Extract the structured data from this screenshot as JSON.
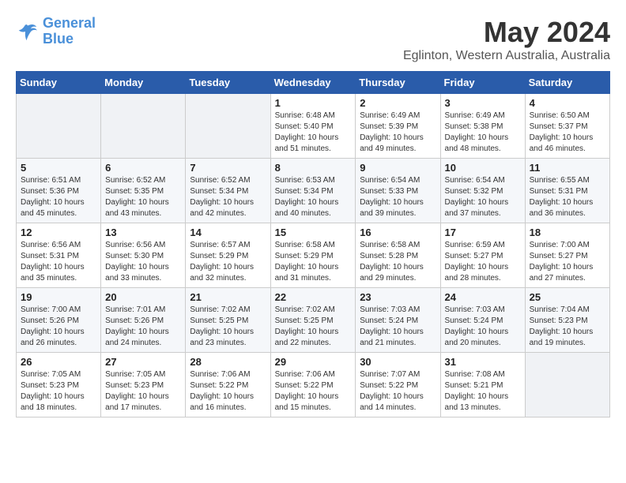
{
  "header": {
    "logo_line1": "General",
    "logo_line2": "Blue",
    "month_title": "May 2024",
    "subtitle": "Eglinton, Western Australia, Australia"
  },
  "weekdays": [
    "Sunday",
    "Monday",
    "Tuesday",
    "Wednesday",
    "Thursday",
    "Friday",
    "Saturday"
  ],
  "weeks": [
    [
      {
        "day": "",
        "info": ""
      },
      {
        "day": "",
        "info": ""
      },
      {
        "day": "",
        "info": ""
      },
      {
        "day": "1",
        "info": "Sunrise: 6:48 AM\nSunset: 5:40 PM\nDaylight: 10 hours\nand 51 minutes."
      },
      {
        "day": "2",
        "info": "Sunrise: 6:49 AM\nSunset: 5:39 PM\nDaylight: 10 hours\nand 49 minutes."
      },
      {
        "day": "3",
        "info": "Sunrise: 6:49 AM\nSunset: 5:38 PM\nDaylight: 10 hours\nand 48 minutes."
      },
      {
        "day": "4",
        "info": "Sunrise: 6:50 AM\nSunset: 5:37 PM\nDaylight: 10 hours\nand 46 minutes."
      }
    ],
    [
      {
        "day": "5",
        "info": "Sunrise: 6:51 AM\nSunset: 5:36 PM\nDaylight: 10 hours\nand 45 minutes."
      },
      {
        "day": "6",
        "info": "Sunrise: 6:52 AM\nSunset: 5:35 PM\nDaylight: 10 hours\nand 43 minutes."
      },
      {
        "day": "7",
        "info": "Sunrise: 6:52 AM\nSunset: 5:34 PM\nDaylight: 10 hours\nand 42 minutes."
      },
      {
        "day": "8",
        "info": "Sunrise: 6:53 AM\nSunset: 5:34 PM\nDaylight: 10 hours\nand 40 minutes."
      },
      {
        "day": "9",
        "info": "Sunrise: 6:54 AM\nSunset: 5:33 PM\nDaylight: 10 hours\nand 39 minutes."
      },
      {
        "day": "10",
        "info": "Sunrise: 6:54 AM\nSunset: 5:32 PM\nDaylight: 10 hours\nand 37 minutes."
      },
      {
        "day": "11",
        "info": "Sunrise: 6:55 AM\nSunset: 5:31 PM\nDaylight: 10 hours\nand 36 minutes."
      }
    ],
    [
      {
        "day": "12",
        "info": "Sunrise: 6:56 AM\nSunset: 5:31 PM\nDaylight: 10 hours\nand 35 minutes."
      },
      {
        "day": "13",
        "info": "Sunrise: 6:56 AM\nSunset: 5:30 PM\nDaylight: 10 hours\nand 33 minutes."
      },
      {
        "day": "14",
        "info": "Sunrise: 6:57 AM\nSunset: 5:29 PM\nDaylight: 10 hours\nand 32 minutes."
      },
      {
        "day": "15",
        "info": "Sunrise: 6:58 AM\nSunset: 5:29 PM\nDaylight: 10 hours\nand 31 minutes."
      },
      {
        "day": "16",
        "info": "Sunrise: 6:58 AM\nSunset: 5:28 PM\nDaylight: 10 hours\nand 29 minutes."
      },
      {
        "day": "17",
        "info": "Sunrise: 6:59 AM\nSunset: 5:27 PM\nDaylight: 10 hours\nand 28 minutes."
      },
      {
        "day": "18",
        "info": "Sunrise: 7:00 AM\nSunset: 5:27 PM\nDaylight: 10 hours\nand 27 minutes."
      }
    ],
    [
      {
        "day": "19",
        "info": "Sunrise: 7:00 AM\nSunset: 5:26 PM\nDaylight: 10 hours\nand 26 minutes."
      },
      {
        "day": "20",
        "info": "Sunrise: 7:01 AM\nSunset: 5:26 PM\nDaylight: 10 hours\nand 24 minutes."
      },
      {
        "day": "21",
        "info": "Sunrise: 7:02 AM\nSunset: 5:25 PM\nDaylight: 10 hours\nand 23 minutes."
      },
      {
        "day": "22",
        "info": "Sunrise: 7:02 AM\nSunset: 5:25 PM\nDaylight: 10 hours\nand 22 minutes."
      },
      {
        "day": "23",
        "info": "Sunrise: 7:03 AM\nSunset: 5:24 PM\nDaylight: 10 hours\nand 21 minutes."
      },
      {
        "day": "24",
        "info": "Sunrise: 7:03 AM\nSunset: 5:24 PM\nDaylight: 10 hours\nand 20 minutes."
      },
      {
        "day": "25",
        "info": "Sunrise: 7:04 AM\nSunset: 5:23 PM\nDaylight: 10 hours\nand 19 minutes."
      }
    ],
    [
      {
        "day": "26",
        "info": "Sunrise: 7:05 AM\nSunset: 5:23 PM\nDaylight: 10 hours\nand 18 minutes."
      },
      {
        "day": "27",
        "info": "Sunrise: 7:05 AM\nSunset: 5:23 PM\nDaylight: 10 hours\nand 17 minutes."
      },
      {
        "day": "28",
        "info": "Sunrise: 7:06 AM\nSunset: 5:22 PM\nDaylight: 10 hours\nand 16 minutes."
      },
      {
        "day": "29",
        "info": "Sunrise: 7:06 AM\nSunset: 5:22 PM\nDaylight: 10 hours\nand 15 minutes."
      },
      {
        "day": "30",
        "info": "Sunrise: 7:07 AM\nSunset: 5:22 PM\nDaylight: 10 hours\nand 14 minutes."
      },
      {
        "day": "31",
        "info": "Sunrise: 7:08 AM\nSunset: 5:21 PM\nDaylight: 10 hours\nand 13 minutes."
      },
      {
        "day": "",
        "info": ""
      }
    ]
  ]
}
